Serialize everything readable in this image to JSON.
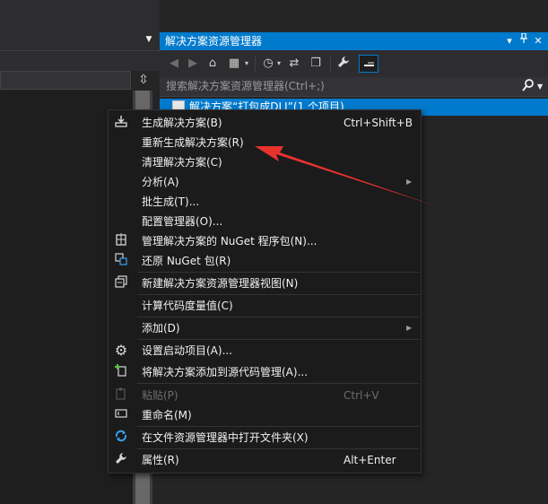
{
  "solution_explorer": {
    "title": "解决方案资源管理器",
    "title_controls": [
      "▾",
      "📌",
      "✕"
    ],
    "search_placeholder": "搜索解决方案资源管理器(Ctrl+;)",
    "selected_item": "解决方案“打包成DLL”(1 个项目)"
  },
  "context_menu": {
    "items": [
      {
        "label": "生成解决方案(B)",
        "shortcut": "Ctrl+Shift+B",
        "icon": "build-icon"
      },
      {
        "label": "重新生成解决方案(R)",
        "shortcut": "",
        "icon": ""
      },
      {
        "label": "清理解决方案(C)",
        "shortcut": "",
        "icon": ""
      },
      {
        "label": "分析(A)",
        "shortcut": "",
        "icon": "",
        "submenu": true
      },
      {
        "label": "批生成(T)...",
        "shortcut": "",
        "icon": ""
      },
      {
        "label": "配置管理器(O)...",
        "shortcut": "",
        "icon": ""
      },
      {
        "label": "管理解决方案的 NuGet 程序包(N)...",
        "shortcut": "",
        "icon": "nuget-package-icon"
      },
      {
        "label": "还原 NuGet 包(R)",
        "shortcut": "",
        "icon": "restore-package-icon"
      },
      {
        "label": "新建解决方案资源管理器视图(N)",
        "shortcut": "",
        "icon": "new-view-icon"
      },
      {
        "label": "计算代码度量值(C)",
        "shortcut": "",
        "icon": ""
      },
      {
        "label": "添加(D)",
        "shortcut": "",
        "icon": "",
        "submenu": true
      },
      {
        "label": "设置启动项目(A)...",
        "shortcut": "",
        "icon": "gear-icon"
      },
      {
        "label": "将解决方案添加到源代码管理(A)...",
        "shortcut": "",
        "icon": "add-source-control-icon"
      },
      {
        "label": "粘贴(P)",
        "shortcut": "Ctrl+V",
        "icon": "paste-icon",
        "disabled": true
      },
      {
        "label": "重命名(M)",
        "shortcut": "",
        "icon": "rename-icon"
      },
      {
        "label": "在文件资源管理器中打开文件夹(X)",
        "shortcut": "",
        "icon": "open-folder-refresh-icon"
      },
      {
        "label": "属性(R)",
        "shortcut": "Alt+Enter",
        "icon": "wrench-icon"
      }
    ]
  },
  "colors": {
    "accent": "#007acc",
    "menu_bg": "#1b1b1c",
    "annotation_arrow": "#e8322e"
  }
}
